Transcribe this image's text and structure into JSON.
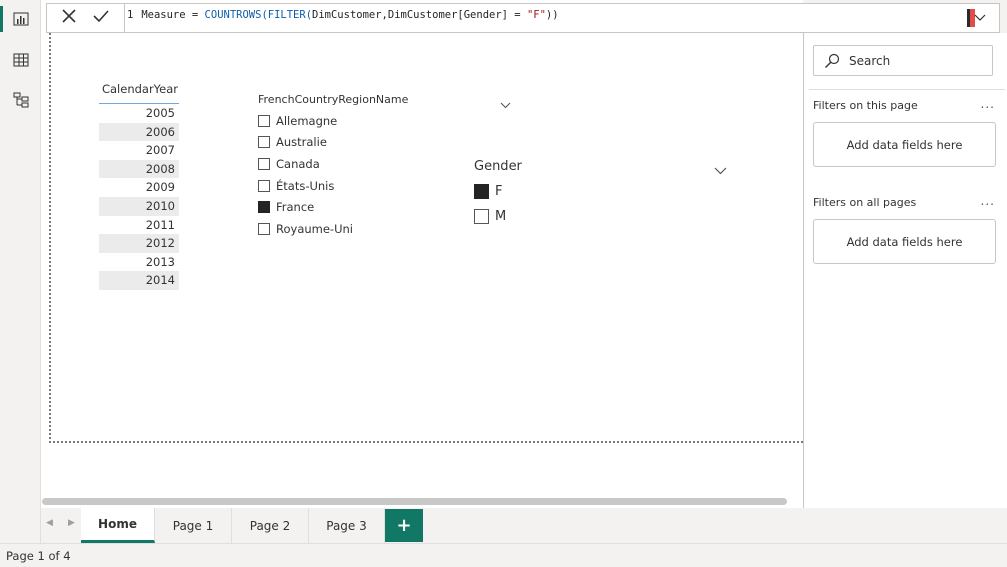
{
  "formula": {
    "line_number": "1",
    "prefix": "Measure = ",
    "function": "COUNTROWS(FILTER(",
    "args": "DimCustomer,DimCustomer[Gender] = ",
    "string_value": "\"F\"",
    "suffix": "))"
  },
  "year_slicer": {
    "header": "CalendarYear",
    "years": [
      "2005",
      "2006",
      "2007",
      "2008",
      "2009",
      "2010",
      "2011",
      "2012",
      "2013",
      "2014"
    ]
  },
  "country_slicer": {
    "title": "FrenchCountryRegionName",
    "items": [
      {
        "label": "Allemagne",
        "checked": false
      },
      {
        "label": "Australie",
        "checked": false
      },
      {
        "label": "Canada",
        "checked": false
      },
      {
        "label": "États-Unis",
        "checked": false
      },
      {
        "label": "France",
        "checked": true
      },
      {
        "label": "Royaume-Uni",
        "checked": false
      }
    ]
  },
  "gender_slicer": {
    "title": "Gender",
    "items": [
      {
        "label": "F",
        "checked": true
      },
      {
        "label": "M",
        "checked": false
      }
    ]
  },
  "filters": {
    "search_label": "Search",
    "on_this_page": "Filters on this page",
    "on_all_pages": "Filters on all pages",
    "drop_zone": "Add data fields here",
    "more": "..."
  },
  "tabs": [
    "Home",
    "Page 1",
    "Page 2",
    "Page 3"
  ],
  "add_tab": "+",
  "status": "Page 1 of 4",
  "colors": {
    "accent": "#117865",
    "selected": "#252423"
  }
}
